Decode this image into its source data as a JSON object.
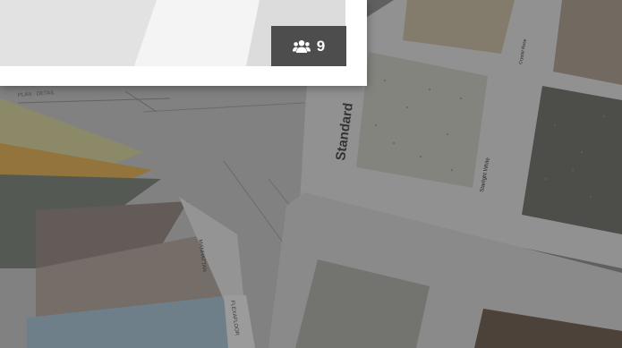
{
  "background_photo": {
    "swatch_labels": {
      "standard": "Standard",
      "starlight_white": "Starlight White",
      "crystal_rose": "Crystal Rose",
      "manhattan": "MANHATTAN",
      "flexafloor": "FLEXAFLOOR"
    }
  },
  "card": {
    "members": {
      "icon": "users-icon",
      "count": "9"
    }
  },
  "colors": {
    "badge_bg": "#4d4d4d",
    "overlay": "rgba(0,0,0,0.30)",
    "card_bg": "#ffffff"
  }
}
